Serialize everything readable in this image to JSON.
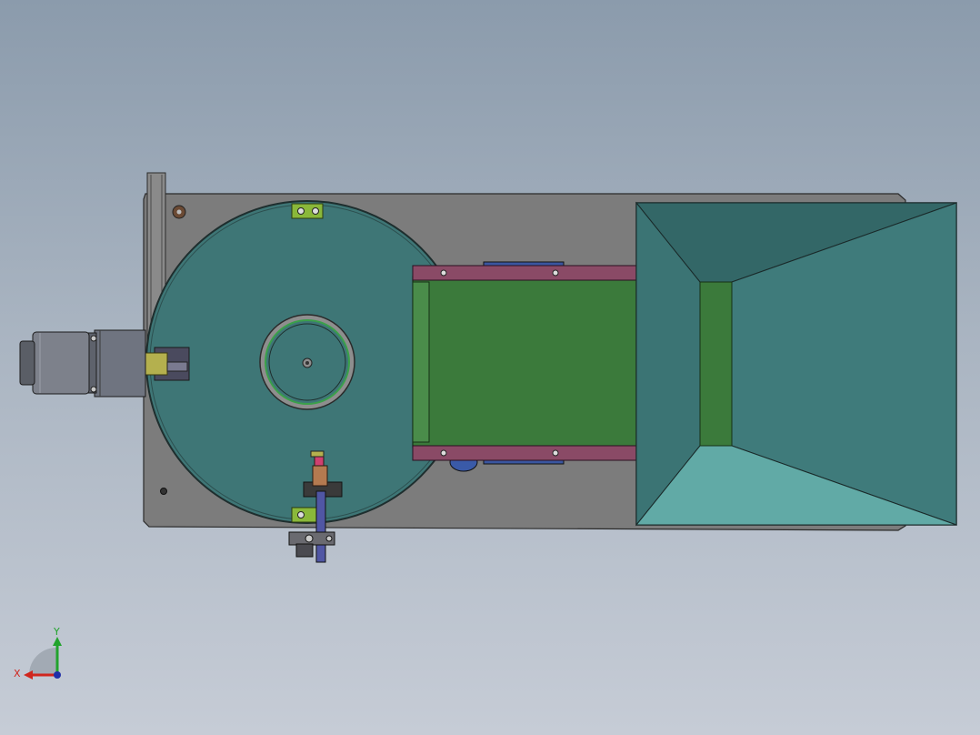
{
  "viewport": {
    "background_top": "#8b9bac",
    "background_bottom": "#c6ccd6"
  },
  "model": {
    "parts": [
      "base-plate",
      "turntable-disc",
      "center-hub",
      "drive-motor",
      "gearbox",
      "vertical-post",
      "conveyor-belt",
      "conveyor-side-rails",
      "hopper",
      "sensor-bracket",
      "clamp-brackets"
    ],
    "colors": {
      "base_plate": "#7c7c7c",
      "turntable": "#3e7676",
      "belt": "#3b7a3b",
      "rails": "#8a4a66",
      "hopper_dark": "#336767",
      "hopper_light": "#61aaa6",
      "motor": "#6f7480",
      "bracket": "#8ab83a"
    }
  },
  "triad": {
    "x_label": "X",
    "y_label": "Y",
    "x_color": "#d0261e",
    "y_color": "#21a32c",
    "z_color": "#1f2ea8"
  }
}
